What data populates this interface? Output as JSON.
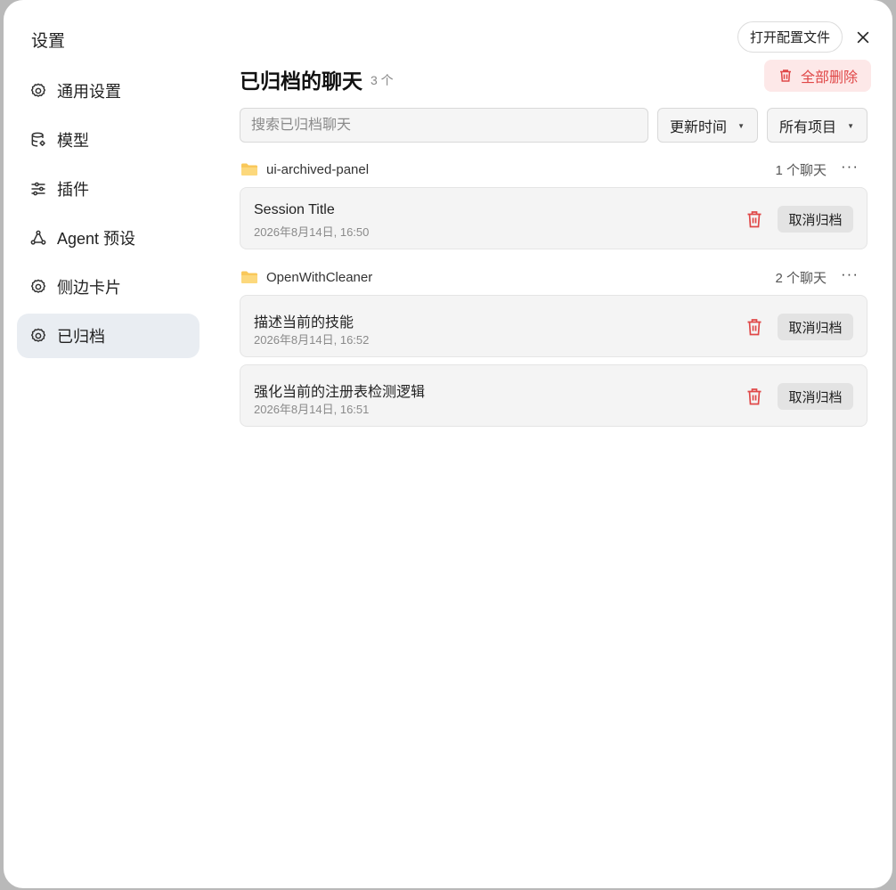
{
  "sidebar": {
    "title": "设置",
    "items": [
      {
        "label": "通用设置",
        "icon": "gear-icon"
      },
      {
        "label": "模型",
        "icon": "database-icon"
      },
      {
        "label": "插件",
        "icon": "sliders-icon"
      },
      {
        "label": "Agent 预设",
        "icon": "agent-icon"
      },
      {
        "label": "侧边卡片",
        "icon": "gear-icon"
      },
      {
        "label": "已归档",
        "icon": "gear-icon",
        "active": true
      }
    ]
  },
  "header": {
    "open_config_label": "打开配置文件",
    "title": "已归档的聊天",
    "count": "3 个",
    "delete_all_label": "全部删除"
  },
  "filters": {
    "search_placeholder": "搜索已归档聊天",
    "sort_value": "更新时间",
    "project_value": "所有项目"
  },
  "groups": [
    {
      "name": "ui-archived-panel",
      "count": "1 个聊天",
      "chats": [
        {
          "title": "Session Title",
          "time": "2026年8月14日, 16:50",
          "unarchive_label": "取消归档"
        }
      ]
    },
    {
      "name": "OpenWithCleaner",
      "count": "2 个聊天",
      "chats": [
        {
          "title": "描述当前的技能",
          "time": "2026年8月14日, 16:52",
          "unarchive_label": "取消归档"
        },
        {
          "title": "强化当前的注册表检测逻辑",
          "time": "2026年8月14日, 16:51",
          "unarchive_label": "取消归档"
        }
      ]
    }
  ],
  "colors": {
    "accent_danger": "#e04848",
    "danger_bg": "#fde8e8",
    "active_nav_bg": "#e9edf2",
    "folder": "#f9c85a"
  }
}
